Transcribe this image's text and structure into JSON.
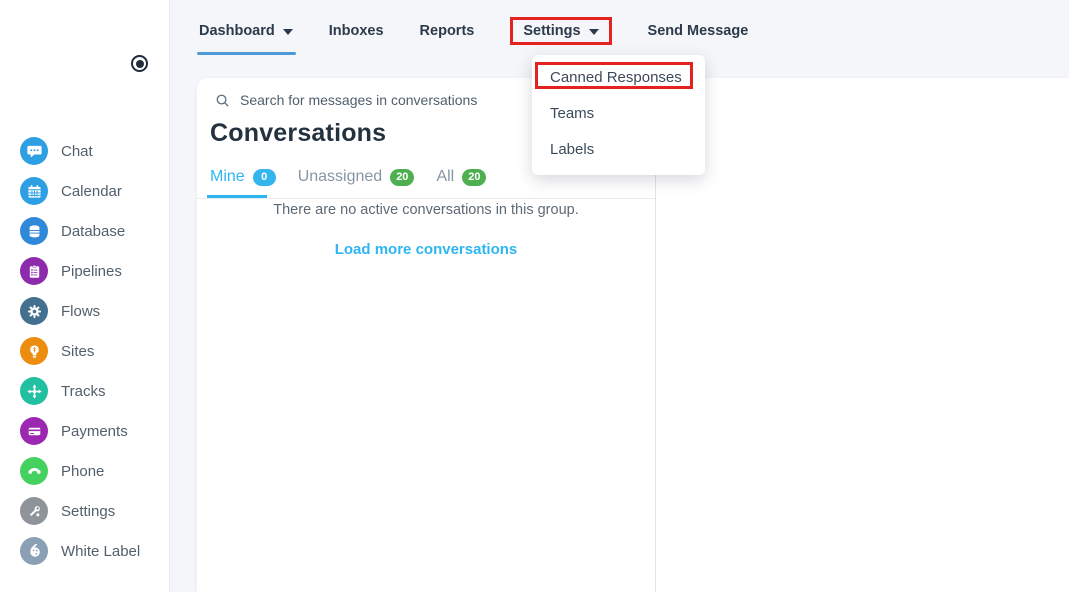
{
  "topnav": {
    "items": [
      {
        "label": "Dashboard"
      },
      {
        "label": "Inboxes"
      },
      {
        "label": "Reports"
      },
      {
        "label": "Settings"
      },
      {
        "label": "Send Message"
      }
    ]
  },
  "settings_dropdown": {
    "items": [
      {
        "label": "Canned Responses",
        "highlighted": true
      },
      {
        "label": "Teams",
        "highlighted": false
      },
      {
        "label": "Labels",
        "highlighted": false
      }
    ]
  },
  "sidebar": {
    "items": [
      {
        "label": "Chat",
        "icon": "chat-bubble-icon",
        "color": "#2f9fe3"
      },
      {
        "label": "Calendar",
        "icon": "calendar-icon",
        "color": "#2f9fe3"
      },
      {
        "label": "Database",
        "icon": "database-icon",
        "color": "#2f89d8"
      },
      {
        "label": "Pipelines",
        "icon": "clipboard-icon",
        "color": "#8e2bad"
      },
      {
        "label": "Flows",
        "icon": "gear-icon",
        "color": "#44708f"
      },
      {
        "label": "Sites",
        "icon": "lightbulb-icon",
        "color": "#ec8d10"
      },
      {
        "label": "Tracks",
        "icon": "arrows-icon",
        "color": "#22bfa0"
      },
      {
        "label": "Payments",
        "icon": "credit-card-icon",
        "color": "#9c27b0"
      },
      {
        "label": "Phone",
        "icon": "phone-icon",
        "color": "#45d15f"
      },
      {
        "label": "Settings",
        "icon": "wrench-icon",
        "color": "#8e9499"
      },
      {
        "label": "White Label",
        "icon": "palette-icon",
        "color": "#8ba0b5"
      }
    ]
  },
  "conversations": {
    "search_placeholder": "Search for messages in conversations",
    "title": "Conversations",
    "tabs": [
      {
        "label": "Mine",
        "count": "0",
        "badge_color": "#35b5ee",
        "active": true
      },
      {
        "label": "Unassigned",
        "count": "20",
        "badge_color": "#4daf50",
        "active": false
      },
      {
        "label": "All",
        "count": "20",
        "badge_color": "#4daf50",
        "active": false
      }
    ],
    "empty_message": "There are no active conversations in this group.",
    "load_more_label": "Load more conversations"
  },
  "colors": {
    "accent_cyan": "#2eb6f2",
    "active_tab_underline": "#4e9ad9",
    "highlight_red": "#e52222",
    "badge_green": "#4daf50",
    "badge_cyan": "#35b5ee",
    "nav_background": "#f4f6f9"
  }
}
